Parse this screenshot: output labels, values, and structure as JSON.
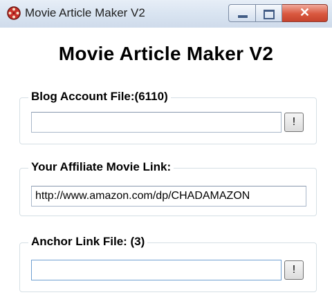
{
  "window": {
    "title": "Movie Article Maker V2",
    "close_glyph": "✕"
  },
  "header": {
    "title": "Movie Article Maker V2"
  },
  "blog_account": {
    "label": "Blog Account File:(6110)",
    "value": "",
    "button_label": "!"
  },
  "affiliate_link": {
    "label": "Your Affiliate Movie Link:",
    "value": "http://www.amazon.com/dp/CHADAMAZON"
  },
  "anchor_link": {
    "label": "Anchor Link File: (3)",
    "value": "",
    "button_label": "!"
  },
  "colors": {
    "titlebar": "#d9e4f1",
    "close_button": "#d9583f",
    "group_border": "#d5dfe5"
  },
  "icons": {
    "app": "film-reel-icon",
    "minimize": "minimize-icon",
    "maximize": "maximize-icon",
    "close": "close-icon"
  }
}
